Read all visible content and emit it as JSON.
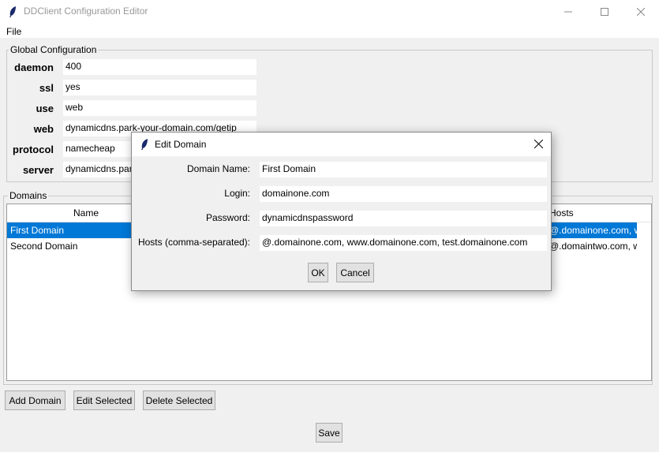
{
  "window": {
    "title": "DDClient Configuration Editor"
  },
  "menu": {
    "file": "File"
  },
  "global": {
    "label": "Global Configuration",
    "fields": [
      {
        "label": "daemon",
        "value": "400"
      },
      {
        "label": "ssl",
        "value": "yes"
      },
      {
        "label": "use",
        "value": "web"
      },
      {
        "label": "web",
        "value": "dynamicdns.park-your-domain.com/getip"
      },
      {
        "label": "protocol",
        "value": "namecheap"
      },
      {
        "label": "server",
        "value": "dynamicdns.park-your-domain.com"
      }
    ]
  },
  "domains": {
    "label": "Domains",
    "columns": {
      "name": "Name",
      "hosts": "Hosts"
    },
    "rows": [
      {
        "name": "First Domain",
        "hosts": "@.domainone.com, www.domainone.com, test.domainone.com",
        "selected": true
      },
      {
        "name": "Second Domain",
        "hosts": "@.domaintwo.com, www.domaintwo.com",
        "selected": false
      }
    ]
  },
  "buttons": {
    "add": "Add Domain",
    "edit": "Edit Selected",
    "delete": "Delete Selected",
    "save": "Save"
  },
  "dialog": {
    "title": "Edit Domain",
    "fields": {
      "name_label": "Domain Name:",
      "name_value": "First Domain",
      "login_label": "Login:",
      "login_value": "domainone.com",
      "password_label": "Password:",
      "password_value": "dynamicdnspassword",
      "hosts_label": "Hosts (comma-separated):",
      "hosts_value": "@.domainone.com, www.domainone.com, test.domainone.com"
    },
    "ok": "OK",
    "cancel": "Cancel"
  },
  "colors": {
    "selection": "#0078d7",
    "window_bg": "#f0f0f0"
  }
}
